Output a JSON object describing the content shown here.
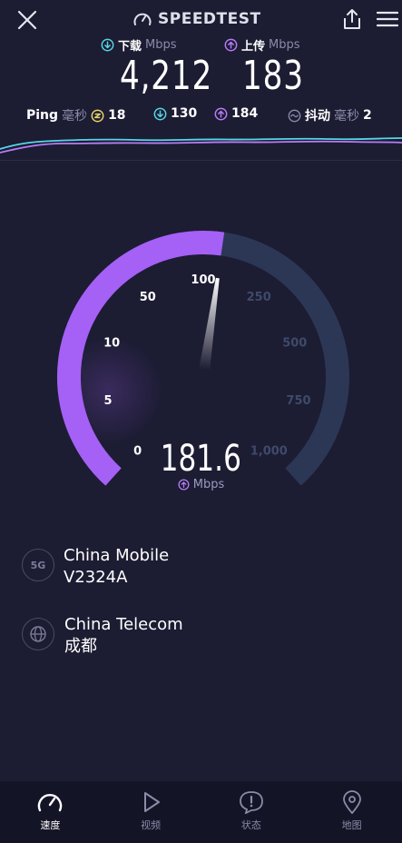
{
  "app": {
    "title": "SPEEDTEST"
  },
  "colors": {
    "background": "#1c1c33",
    "download_accent": "#55d6e3",
    "upload_accent": "#b77cf6",
    "gauge_fill": "#a560f5",
    "gauge_track": "#2c3756"
  },
  "download": {
    "label": "下载",
    "unit": "Mbps",
    "value": "4,212"
  },
  "upload": {
    "label": "上传",
    "unit": "Mbps",
    "value": "183"
  },
  "ping": {
    "label": "Ping",
    "unit": "毫秒",
    "idle": "18",
    "download": "130",
    "upload": "184",
    "jitter_label": "抖动",
    "jitter_unit": "毫秒",
    "jitter": "2"
  },
  "gauge": {
    "ticks": [
      "0",
      "5",
      "10",
      "50",
      "100",
      "250",
      "500",
      "750",
      "1,000"
    ],
    "current_value": "181.6",
    "unit": "Mbps",
    "fill_fraction": 0.53
  },
  "network": {
    "carrier_icon": "5G",
    "carrier": "China Mobile",
    "device": "V2324A",
    "isp": "China Telecom",
    "location": "成都"
  },
  "nav": [
    {
      "label": "速度",
      "icon": "speedometer-icon"
    },
    {
      "label": "视频",
      "icon": "play-icon"
    },
    {
      "label": "状态",
      "icon": "alert-icon"
    },
    {
      "label": "地图",
      "icon": "map-pin-icon"
    }
  ]
}
